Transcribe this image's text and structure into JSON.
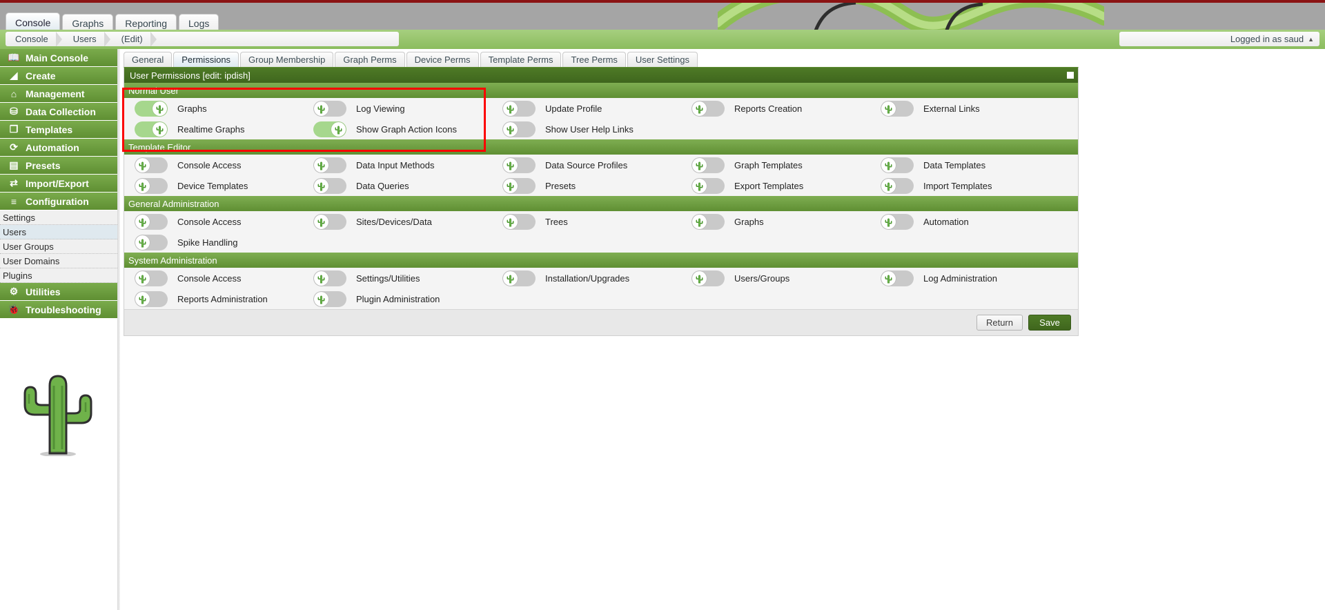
{
  "colors": {
    "accent_green": "#5f8f33",
    "dark_green": "#3f661d",
    "toggle_on": "#a6d78d",
    "toggle_off": "#c9c9c9",
    "annotation_red": "#fc0000",
    "top_strip_red": "#8b1414",
    "header_grey": "#a5a5a5",
    "selected_tab_blue": "#dce8f0"
  },
  "header": {
    "main_tabs": [
      {
        "label": "Console",
        "selected": true
      },
      {
        "label": "Graphs",
        "selected": false
      },
      {
        "label": "Reporting",
        "selected": false
      },
      {
        "label": "Logs",
        "selected": false
      }
    ],
    "breadcrumb": [
      "Console",
      "Users",
      "(Edit)"
    ],
    "login_text": "Logged in as saud",
    "login_caret": "▲"
  },
  "sidebar": {
    "main_items": [
      {
        "label": "Main Console",
        "icon": "book-icon",
        "glyph": "📖"
      },
      {
        "label": "Create",
        "icon": "chart-area-icon",
        "glyph": "◢"
      },
      {
        "label": "Management",
        "icon": "home-icon",
        "glyph": "⌂"
      },
      {
        "label": "Data Collection",
        "icon": "database-icon",
        "glyph": "⛁"
      },
      {
        "label": "Templates",
        "icon": "copy-icon",
        "glyph": "❐"
      },
      {
        "label": "Automation",
        "icon": "refresh-icon",
        "glyph": "⟳"
      },
      {
        "label": "Presets",
        "icon": "archive-icon",
        "glyph": "▤"
      },
      {
        "label": "Import/Export",
        "icon": "exchange-icon",
        "glyph": "⇄"
      },
      {
        "label": "Configuration",
        "icon": "sliders-icon",
        "glyph": "≡"
      }
    ],
    "sub_items": [
      {
        "label": "Settings",
        "selected": false
      },
      {
        "label": "Users",
        "selected": true
      },
      {
        "label": "User Groups",
        "selected": false
      },
      {
        "label": "User Domains",
        "selected": false
      },
      {
        "label": "Plugins",
        "selected": false
      }
    ],
    "trailing_items": [
      {
        "label": "Utilities",
        "icon": "cogs-icon",
        "glyph": "⚙"
      },
      {
        "label": "Troubleshooting",
        "icon": "bug-icon",
        "glyph": "🐞"
      }
    ],
    "mascot": "cactus-mascot"
  },
  "content": {
    "sub_tabs": [
      {
        "label": "General",
        "selected": false
      },
      {
        "label": "Permissions",
        "selected": true
      },
      {
        "label": "Group Membership",
        "selected": false
      },
      {
        "label": "Graph Perms",
        "selected": false
      },
      {
        "label": "Device Perms",
        "selected": false
      },
      {
        "label": "Template Perms",
        "selected": false
      },
      {
        "label": "Tree Perms",
        "selected": false
      },
      {
        "label": "User Settings",
        "selected": false
      }
    ],
    "panel_title": "User Permissions [edit: ipdish]",
    "sections": [
      {
        "title": "Normal User",
        "rows": [
          [
            {
              "label": "Graphs",
              "on": true
            },
            {
              "label": "Log Viewing",
              "on": false
            },
            {
              "label": "Update Profile",
              "on": false
            },
            {
              "label": "Reports Creation",
              "on": false
            },
            {
              "label": "External Links",
              "on": false
            }
          ],
          [
            {
              "label": "Realtime Graphs",
              "on": true
            },
            {
              "label": "Show Graph Action Icons",
              "on": true
            },
            {
              "label": "Show User Help Links",
              "on": false
            },
            {
              "label": "",
              "on": null
            },
            {
              "label": "",
              "on": null
            }
          ]
        ]
      },
      {
        "title": "Template Editor",
        "rows": [
          [
            {
              "label": "Console Access",
              "on": false
            },
            {
              "label": "Data Input Methods",
              "on": false
            },
            {
              "label": "Data Source Profiles",
              "on": false
            },
            {
              "label": "Graph Templates",
              "on": false
            },
            {
              "label": "Data Templates",
              "on": false
            }
          ],
          [
            {
              "label": "Device Templates",
              "on": false
            },
            {
              "label": "Data Queries",
              "on": false
            },
            {
              "label": "Presets",
              "on": false
            },
            {
              "label": "Export Templates",
              "on": false
            },
            {
              "label": "Import Templates",
              "on": false
            }
          ]
        ]
      },
      {
        "title": "General Administration",
        "rows": [
          [
            {
              "label": "Console Access",
              "on": false
            },
            {
              "label": "Sites/Devices/Data",
              "on": false
            },
            {
              "label": "Trees",
              "on": false
            },
            {
              "label": "Graphs",
              "on": false
            },
            {
              "label": "Automation",
              "on": false
            }
          ],
          [
            {
              "label": "Spike Handling",
              "on": false
            },
            {
              "label": "",
              "on": null
            },
            {
              "label": "",
              "on": null
            },
            {
              "label": "",
              "on": null
            },
            {
              "label": "",
              "on": null
            }
          ]
        ]
      },
      {
        "title": "System Administration",
        "rows": [
          [
            {
              "label": "Console Access",
              "on": false
            },
            {
              "label": "Settings/Utilities",
              "on": false
            },
            {
              "label": "Installation/Upgrades",
              "on": false
            },
            {
              "label": "Users/Groups",
              "on": false
            },
            {
              "label": "Log Administration",
              "on": false
            }
          ],
          [
            {
              "label": "Reports Administration",
              "on": false
            },
            {
              "label": "Plugin Administration",
              "on": false
            },
            {
              "label": "",
              "on": null
            },
            {
              "label": "",
              "on": null
            },
            {
              "label": "",
              "on": null
            }
          ]
        ]
      }
    ],
    "footer": {
      "return_label": "Return",
      "save_label": "Save"
    }
  }
}
